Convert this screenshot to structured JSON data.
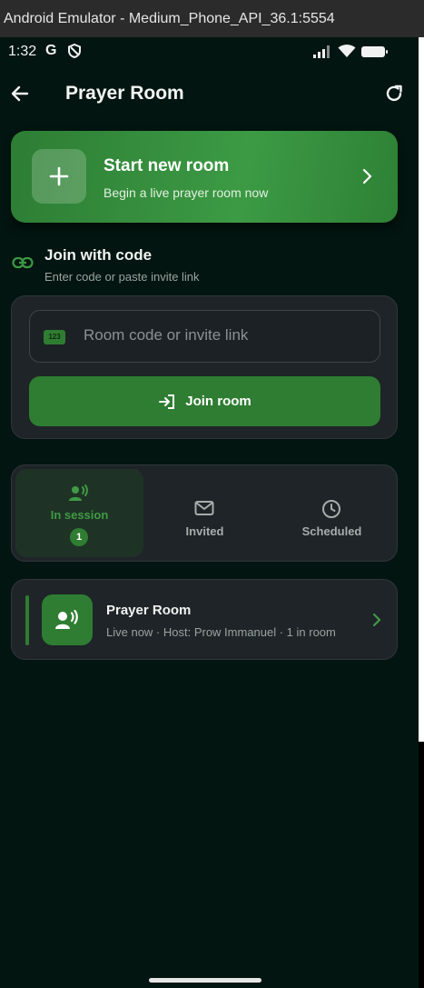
{
  "window": {
    "title": "Android Emulator - Medium_Phone_API_36.1:5554"
  },
  "status_bar": {
    "time": "1:32",
    "g_label": "G"
  },
  "app_bar": {
    "title": "Prayer Room"
  },
  "start_room": {
    "title": "Start new room",
    "subtitle": "Begin a live prayer room now"
  },
  "join": {
    "title": "Join with code",
    "subtitle": "Enter code or paste invite link",
    "input_icon_text": "123",
    "placeholder": "Room code or invite link",
    "button_label": "Join room"
  },
  "tabs": [
    {
      "label": "In session",
      "badge": "1",
      "active": true,
      "icon": "person-voice-icon"
    },
    {
      "label": "Invited",
      "active": false,
      "icon": "mail-icon"
    },
    {
      "label": "Scheduled",
      "active": false,
      "icon": "clock-icon"
    }
  ],
  "rooms": [
    {
      "title": "Prayer Room",
      "subtitle": "Live now · Host: Prow Immanuel · 1 in room"
    }
  ],
  "colors": {
    "accent": "#2e7d32",
    "background": "#031510",
    "card": "#1f2428",
    "active_tab": "#1e3325",
    "active_text": "#3f9a46",
    "inactive_text": "#a6adaa"
  }
}
